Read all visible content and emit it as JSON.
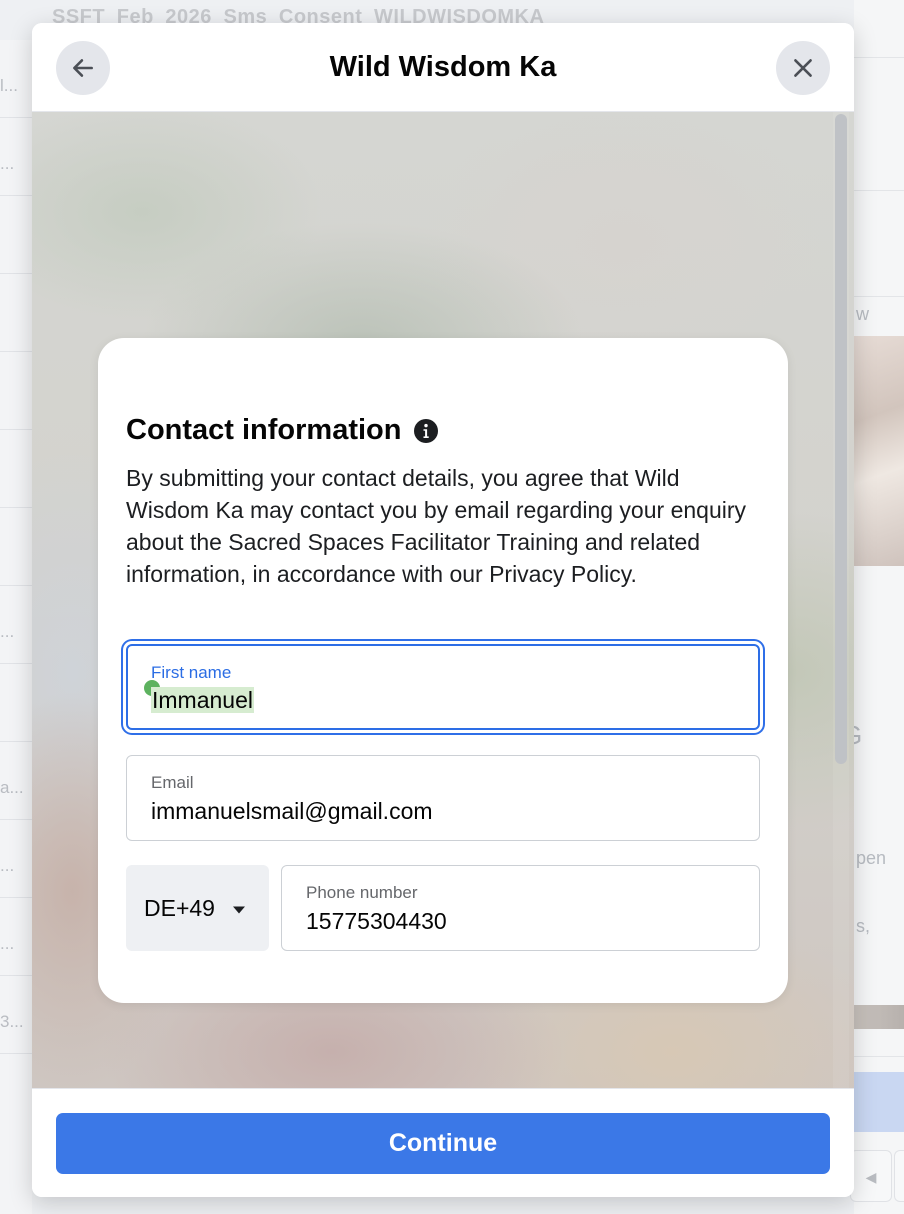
{
  "background": {
    "heading": "SSFT_Feb_2026_Sms_Consent_WILDWISDOMKA",
    "left_rows": [
      "l...",
      "...",
      "",
      "",
      "",
      "",
      "",
      "...",
      "",
      "a...",
      "...",
      "...",
      "3..."
    ],
    "right_texts": [
      "w",
      "G",
      "pen",
      "s,"
    ]
  },
  "dialog": {
    "title": "Wild Wisdom Ka",
    "back_icon": "arrow-left-icon",
    "close_icon": "close-icon"
  },
  "form": {
    "section_title": "Contact information",
    "info_icon": "info-icon",
    "description": "By submitting your contact details, you agree that Wild Wisdom Ka may contact you by email regarding your enquiry about the Sacred Spaces Facilitator Training and related information, in accordance with our Privacy Policy.",
    "first_name": {
      "label": "First name",
      "value": "Immanuel"
    },
    "email": {
      "label": "Email",
      "value": "immanuelsmail@gmail.com"
    },
    "country_code": {
      "value": "DE+49",
      "icon": "caret-down-icon"
    },
    "phone": {
      "label": "Phone number",
      "value": "15775304430"
    }
  },
  "footer": {
    "continue_label": "Continue"
  },
  "colors": {
    "primary": "#3b78e7",
    "focus_border": "#2d6ee6",
    "autofill_highlight": "#d6ecd0",
    "cursor_dot": "#5db25f"
  }
}
